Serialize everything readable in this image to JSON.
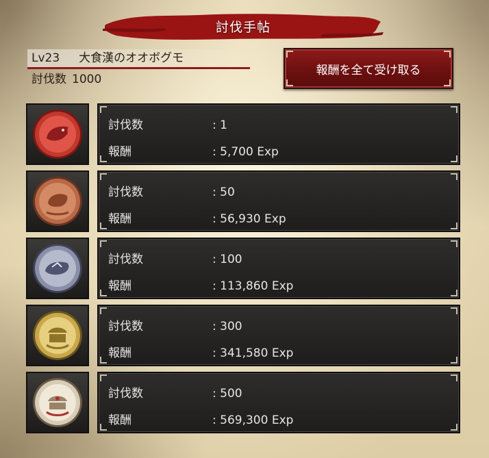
{
  "header": {
    "title": "討伐手帖"
  },
  "target": {
    "level": "Lv23",
    "name": "大食漢のオオボグモ",
    "count_label": "討伐数",
    "count": "1000"
  },
  "claim_button": {
    "label": "報酬を全て受け取る"
  },
  "rows": [
    {
      "kills_label": "討伐数",
      "kills": ": 1",
      "reward_label": "報酬",
      "reward": ": 5,700 Exp",
      "medal": "red-medal-icon"
    },
    {
      "kills_label": "討伐数",
      "kills": ": 50",
      "reward_label": "報酬",
      "reward": ": 56,930 Exp",
      "medal": "bronze-medal-icon"
    },
    {
      "kills_label": "討伐数",
      "kills": ": 100",
      "reward_label": "報酬",
      "reward": ": 113,860 Exp",
      "medal": "silver-medal-icon"
    },
    {
      "kills_label": "討伐数",
      "kills": ": 300",
      "reward_label": "報酬",
      "reward": ": 341,580 Exp",
      "medal": "gold-medal-icon"
    },
    {
      "kills_label": "討伐数",
      "kills": ": 500",
      "reward_label": "報酬",
      "reward": ": 569,300 Exp",
      "medal": "platinum-medal-icon"
    }
  ],
  "colors": {
    "accent": "#8e1c1c",
    "panel": "#262523",
    "parchment": "#e6d8b4"
  }
}
